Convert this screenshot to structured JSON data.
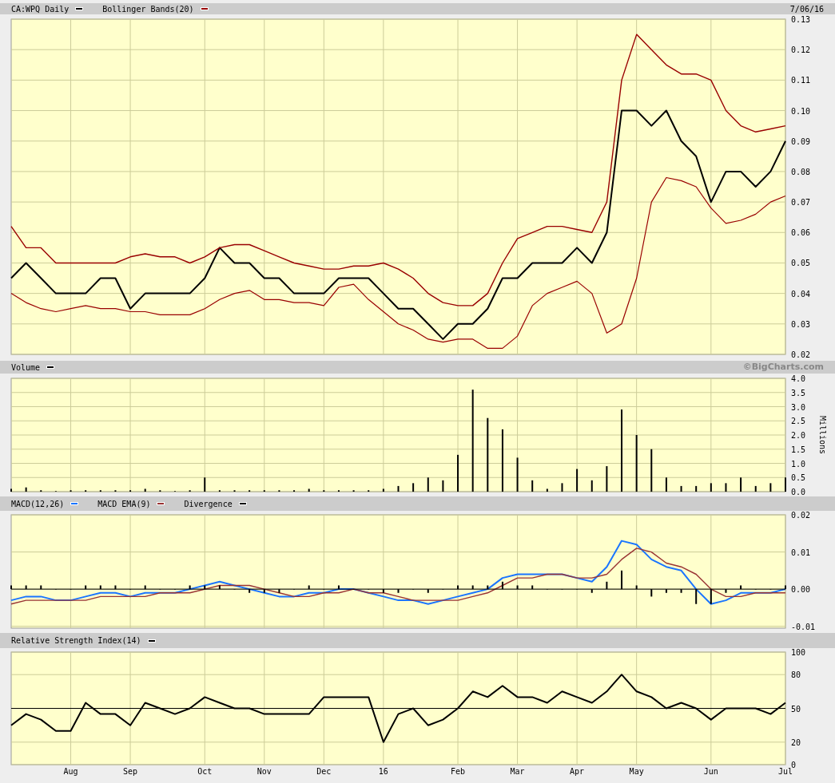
{
  "panels": [
    {
      "kind": "price",
      "right_text": "7/06/16",
      "chart_data": {
        "type": "line",
        "grid": true,
        "categories": [
          null,
          null,
          null,
          null,
          null,
          null,
          null,
          null,
          null,
          null,
          null,
          null,
          null,
          null,
          null,
          null,
          null,
          null,
          null,
          null,
          null,
          null,
          null,
          null,
          null,
          null,
          null,
          null,
          null,
          null,
          null,
          null,
          null,
          null,
          null,
          null,
          null,
          null,
          null,
          null,
          null,
          null,
          null,
          null,
          null,
          null,
          null,
          null,
          null,
          null,
          null,
          null,
          null
        ],
        "ylim": [
          0.02,
          0.13
        ],
        "yticks": [
          {
            "value": 0.02,
            "label": "0.02"
          },
          {
            "value": 0.03,
            "label": "0.03"
          },
          {
            "value": 0.04,
            "label": "0.04"
          },
          {
            "value": 0.05,
            "label": "0.05"
          },
          {
            "value": 0.06,
            "label": "0.06"
          },
          {
            "value": 0.07,
            "label": "0.07"
          },
          {
            "value": 0.08,
            "label": "0.08"
          },
          {
            "value": 0.09,
            "label": "0.09"
          },
          {
            "value": 0.1,
            "label": "0.10"
          },
          {
            "value": 0.11,
            "label": "0.11"
          },
          {
            "value": 0.12,
            "label": "0.12"
          },
          {
            "value": 0.13,
            "label": "0.13"
          }
        ],
        "series": [
          {
            "name": "CA:WPQ Daily",
            "color": "#000000",
            "values": [
              0.045,
              0.05,
              0.045,
              0.04,
              0.04,
              0.04,
              0.045,
              0.045,
              0.035,
              0.04,
              0.04,
              0.04,
              0.04,
              0.045,
              0.055,
              0.05,
              0.05,
              0.045,
              0.045,
              0.04,
              0.04,
              0.04,
              0.045,
              0.045,
              0.045,
              0.04,
              0.035,
              0.035,
              0.03,
              0.025,
              0.03,
              0.03,
              0.035,
              0.045,
              0.045,
              0.05,
              0.05,
              0.05,
              0.055,
              0.05,
              0.06,
              0.1,
              0.1,
              0.095,
              0.1,
              0.09,
              0.085,
              0.07,
              0.08,
              0.08,
              0.075,
              0.08,
              0.09
            ]
          },
          {
            "name": "Bollinger Bands(20)",
            "color": "#990000",
            "values": [
              0.062,
              0.055,
              0.055,
              0.05,
              0.05,
              0.05,
              0.05,
              0.05,
              0.052,
              0.053,
              0.052,
              0.052,
              0.05,
              0.052,
              0.055,
              0.056,
              0.056,
              0.054,
              0.052,
              0.05,
              0.049,
              0.048,
              0.048,
              0.049,
              0.049,
              0.05,
              0.048,
              0.045,
              0.04,
              0.037,
              0.036,
              0.036,
              0.04,
              0.05,
              0.058,
              0.06,
              0.062,
              0.062,
              0.061,
              0.06,
              0.07,
              0.11,
              0.125,
              0.12,
              0.115,
              0.112,
              0.112,
              0.11,
              0.1,
              0.095,
              0.093,
              0.094,
              0.095
            ]
          },
          {
            "color": "#990000",
            "values": [
              0.04,
              0.037,
              0.035,
              0.034,
              0.035,
              0.036,
              0.035,
              0.035,
              0.034,
              0.034,
              0.033,
              0.033,
              0.033,
              0.035,
              0.038,
              0.04,
              0.041,
              0.038,
              0.038,
              0.037,
              0.037,
              0.036,
              0.042,
              0.043,
              0.038,
              0.034,
              0.03,
              0.028,
              0.025,
              0.024,
              0.025,
              0.025,
              0.022,
              0.022,
              0.026,
              0.036,
              0.04,
              0.042,
              0.044,
              0.04,
              0.027,
              0.03,
              0.045,
              0.07,
              0.078,
              0.077,
              0.075,
              0.068,
              0.063,
              0.064,
              0.066,
              0.07,
              0.072
            ]
          }
        ]
      }
    },
    {
      "kind": "volume",
      "right_text": "©BigCharts.com",
      "chart_data": {
        "type": "bar",
        "grid": true,
        "ylabel": "Millions",
        "categories": [
          null,
          null,
          null,
          null,
          null,
          null,
          null,
          null,
          null,
          null,
          null,
          null,
          null,
          null,
          null,
          null,
          null,
          null,
          null,
          null,
          null,
          null,
          null,
          null,
          null,
          null,
          null,
          null,
          null,
          null,
          null,
          null,
          null,
          null,
          null,
          null,
          null,
          null,
          null,
          null,
          null,
          null,
          null,
          null,
          null,
          null,
          null,
          null,
          null,
          null,
          null,
          null,
          null
        ],
        "ylim": [
          0,
          4
        ],
        "yticks": [
          {
            "value": 0,
            "label": "0.0"
          },
          {
            "value": 0.5,
            "label": "0.5"
          },
          {
            "value": 1,
            "label": "1.0"
          },
          {
            "value": 1.5,
            "label": "1.5"
          },
          {
            "value": 2,
            "label": "2.0"
          },
          {
            "value": 2.5,
            "label": "2.5"
          },
          {
            "value": 3,
            "label": "3.0"
          },
          {
            "value": 3.5,
            "label": "3.5"
          },
          {
            "value": 4,
            "label": "4.0"
          }
        ],
        "series": [
          {
            "name": "Volume",
            "color": "#000000",
            "values": [
              0.1,
              0.15,
              0.05,
              0.02,
              0.05,
              0.05,
              0.05,
              0.05,
              0.05,
              0.1,
              0.05,
              0.02,
              0.05,
              0.5,
              0.05,
              0.05,
              0.05,
              0.05,
              0.05,
              0.05,
              0.1,
              0.05,
              0.05,
              0.05,
              0.05,
              0.1,
              0.2,
              0.3,
              0.5,
              0.4,
              1.3,
              3.6,
              2.6,
              2.2,
              1.2,
              0.4,
              0.1,
              0.3,
              0.8,
              0.4,
              0.9,
              2.9,
              2.0,
              1.5,
              0.5,
              0.2,
              0.2,
              0.3,
              0.3,
              0.5,
              0.2,
              0.3,
              0.5
            ]
          }
        ]
      }
    },
    {
      "kind": "macd",
      "chart_data": {
        "type": "line",
        "grid": true,
        "ref_lines": [
          {
            "axis": "y",
            "value": 0
          }
        ],
        "categories": [
          null,
          null,
          null,
          null,
          null,
          null,
          null,
          null,
          null,
          null,
          null,
          null,
          null,
          null,
          null,
          null,
          null,
          null,
          null,
          null,
          null,
          null,
          null,
          null,
          null,
          null,
          null,
          null,
          null,
          null,
          null,
          null,
          null,
          null,
          null,
          null,
          null,
          null,
          null,
          null,
          null,
          null,
          null,
          null,
          null,
          null,
          null,
          null,
          null,
          null,
          null,
          null,
          null
        ],
        "ylim": [
          -0.0105,
          0.02
        ],
        "yticks": [
          {
            "value": -0.01,
            "label": "-0.01"
          },
          {
            "value": 0,
            "label": "0.00"
          },
          {
            "value": 0.01,
            "label": "0.01"
          },
          {
            "value": 0.02,
            "label": "0.02"
          }
        ],
        "series": [
          {
            "name": "MACD(12,26)",
            "color": "#1a75ff",
            "values": [
              -0.003,
              -0.002,
              -0.002,
              -0.003,
              -0.003,
              -0.002,
              -0.001,
              -0.001,
              -0.002,
              -0.001,
              -0.001,
              -0.001,
              0.0,
              0.001,
              0.002,
              0.001,
              0.0,
              -0.001,
              -0.002,
              -0.002,
              -0.001,
              -0.001,
              0.0,
              0.0,
              -0.001,
              -0.002,
              -0.003,
              -0.003,
              -0.004,
              -0.003,
              -0.002,
              -0.001,
              0.0,
              0.003,
              0.004,
              0.004,
              0.004,
              0.004,
              0.003,
              0.002,
              0.006,
              0.013,
              0.012,
              0.008,
              0.006,
              0.005,
              0.0,
              -0.004,
              -0.003,
              -0.001,
              -0.001,
              -0.001,
              0.0
            ]
          },
          {
            "name": "MACD EMA(9)",
            "color": "#993333",
            "values": [
              -0.004,
              -0.003,
              -0.003,
              -0.003,
              -0.003,
              -0.003,
              -0.002,
              -0.002,
              -0.002,
              -0.002,
              -0.001,
              -0.001,
              -0.001,
              0.0,
              0.001,
              0.001,
              0.001,
              0.0,
              -0.001,
              -0.002,
              -0.002,
              -0.001,
              -0.001,
              0.0,
              -0.001,
              -0.001,
              -0.002,
              -0.003,
              -0.003,
              -0.003,
              -0.003,
              -0.002,
              -0.001,
              0.001,
              0.003,
              0.003,
              0.004,
              0.004,
              0.003,
              0.003,
              0.004,
              0.008,
              0.011,
              0.01,
              0.007,
              0.006,
              0.004,
              0.0,
              -0.002,
              -0.002,
              -0.001,
              -0.001,
              -0.001
            ]
          },
          {
            "name": "Divergence",
            "type": "bar",
            "color": "#000000",
            "values": [
              0.001,
              0.001,
              0.001,
              0.0,
              0.0,
              0.001,
              0.001,
              0.001,
              0.0,
              0.001,
              0.0,
              0.0,
              0.001,
              0.001,
              0.001,
              0.0,
              -0.001,
              -0.001,
              -0.001,
              0.0,
              0.001,
              0.0,
              0.001,
              0.0,
              0.0,
              -0.001,
              -0.001,
              0.0,
              -0.001,
              0.0,
              0.001,
              0.001,
              0.001,
              0.002,
              0.001,
              0.001,
              0.0,
              0.0,
              0.0,
              -0.001,
              0.002,
              0.005,
              0.001,
              -0.002,
              -0.001,
              -0.001,
              -0.004,
              -0.004,
              -0.001,
              0.001,
              0.0,
              0.0,
              0.001
            ]
          }
        ]
      }
    },
    {
      "kind": "rsi",
      "chart_data": {
        "type": "line",
        "grid": true,
        "ref_lines": [
          {
            "axis": "y",
            "value": 50
          }
        ],
        "categories": [
          null,
          null,
          null,
          null,
          "Aug",
          null,
          null,
          null,
          "Sep",
          null,
          null,
          null,
          null,
          "Oct",
          null,
          null,
          null,
          "Nov",
          null,
          null,
          null,
          "Dec",
          null,
          null,
          null,
          "16",
          null,
          null,
          null,
          null,
          "Feb",
          null,
          null,
          null,
          "Mar",
          null,
          null,
          null,
          "Apr",
          null,
          null,
          null,
          "May",
          null,
          null,
          null,
          null,
          "Jun",
          null,
          null,
          null,
          null,
          "Jul"
        ],
        "ylim": [
          0,
          100
        ],
        "yticks": [
          {
            "value": 0,
            "label": "0"
          },
          {
            "value": 20,
            "label": "20"
          },
          {
            "value": 50,
            "label": "50"
          },
          {
            "value": 80,
            "label": "80"
          },
          {
            "value": 100,
            "label": "100"
          }
        ],
        "series": [
          {
            "name": "Relative Strength Index(14)",
            "color": "#000000",
            "values": [
              35,
              45,
              40,
              30,
              30,
              55,
              45,
              45,
              35,
              55,
              50,
              45,
              50,
              60,
              55,
              50,
              50,
              45,
              45,
              45,
              45,
              60,
              60,
              60,
              60,
              20,
              45,
              50,
              35,
              40,
              50,
              65,
              60,
              70,
              60,
              60,
              55,
              65,
              60,
              55,
              65,
              80,
              65,
              60,
              50,
              55,
              50,
              40,
              50,
              50,
              50,
              45,
              55
            ]
          }
        ]
      }
    }
  ]
}
